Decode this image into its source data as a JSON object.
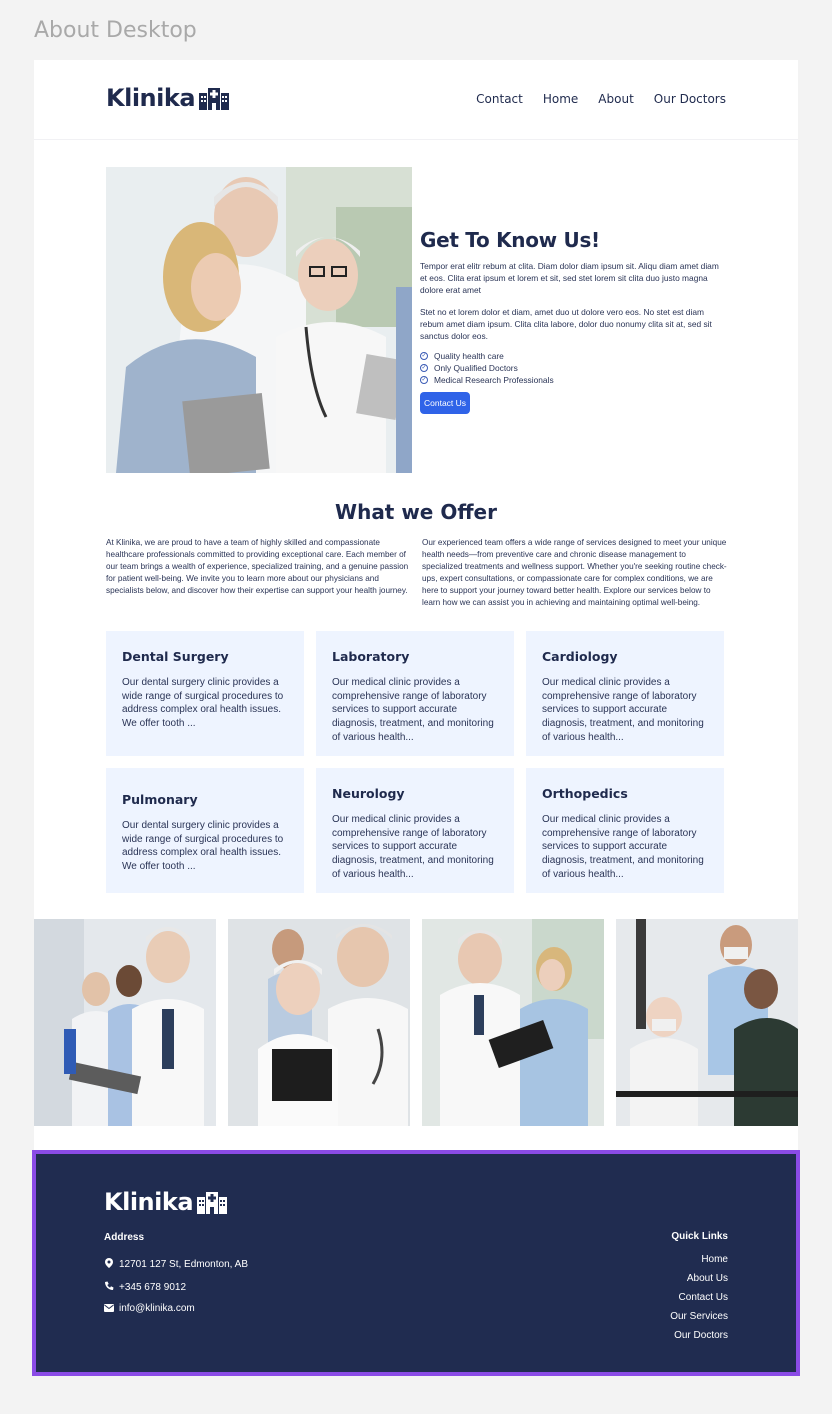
{
  "frame": {
    "label": "About Desktop"
  },
  "header": {
    "logo": "Klinika",
    "nav": [
      "Contact",
      "Home",
      "About",
      "Our Doctors"
    ]
  },
  "about": {
    "title": "Get To Know Us!",
    "p1": "Tempor erat elitr rebum at clita. Diam dolor diam ipsum sit. Aliqu diam amet diam et eos. Clita erat ipsum et lorem et  sit, sed stet lorem sit clita duo justo magna dolore erat amet",
    "p2": "Stet no et lorem dolor et diam, amet duo ut dolore vero eos. No stet est diam rebum amet diam ipsum. Clita  clita labore, dolor duo nonumy clita sit at, sed sit sanctus dolor eos.",
    "checks": [
      "Quality health care",
      "Only Qualified Doctors",
      "Medical Research Professionals"
    ],
    "button": "Contact Us"
  },
  "offer": {
    "title": "What we Offer",
    "left": "At Klinika, we are proud to have a team of highly skilled and compassionate healthcare professionals committed to providing exceptional care. Each member of our team brings a wealth of experience, specialized training, and a genuine passion for patient well-being. We invite you to learn more about our physicians and specialists below, and discover how their expertise can support your health journey.",
    "right": "Our experienced team offers a wide range of services designed to meet your unique health needs—from preventive care and chronic disease management to specialized treatments and wellness support. Whether you're seeking routine check-ups, expert consultations, or compassionate care for complex conditions, we are here to support your journey toward better health. Explore our services below to learn how we can assist you in achieving and maintaining optimal well-being.",
    "cards": [
      {
        "title": "Dental Surgery",
        "text": "Our dental surgery clinic provides a wide range of surgical procedures to address complex oral health issues. We offer tooth ..."
      },
      {
        "title": "Laboratory",
        "text": "Our medical clinic provides a comprehensive range of laboratory services to support accurate diagnosis, treatment, and monitoring of various health..."
      },
      {
        "title": "Cardiology",
        "text": "Our medical clinic provides a comprehensive range of laboratory services to support accurate diagnosis, treatment, and monitoring of various health..."
      },
      {
        "title": "Pulmonary",
        "text": "Our dental surgery clinic provides a wide range of surgical procedures to address complex oral health issues. We offer tooth ..."
      },
      {
        "title": "Neurology",
        "text": "Our medical clinic provides a comprehensive range of laboratory services to support accurate diagnosis, treatment, and monitoring of various health..."
      },
      {
        "title": "Orthopedics",
        "text": "Our medical clinic provides a comprehensive range of laboratory services to support accurate diagnosis, treatment, and monitoring of various health..."
      }
    ]
  },
  "footer": {
    "logo": "Klinika",
    "address_title": "Address",
    "address": "12701 127 St, Edmonton, AB",
    "phone": "+345 678 9012",
    "email": "info@klinika.com",
    "quick_links_title": "Quick Links",
    "quick_links": [
      "Home",
      "About Us",
      "Contact Us",
      "Our Services",
      "Our Doctors"
    ]
  },
  "colors": {
    "navy": "#1f2a4d",
    "footer_bg": "#202c50",
    "accent_blue": "#2f63e8",
    "card_bg": "#eef4ff",
    "selection_outline": "#8a4be6"
  },
  "icons": [
    "hospital-logo-icon",
    "check-circle-icon",
    "map-pin-icon",
    "phone-icon",
    "envelope-icon"
  ]
}
